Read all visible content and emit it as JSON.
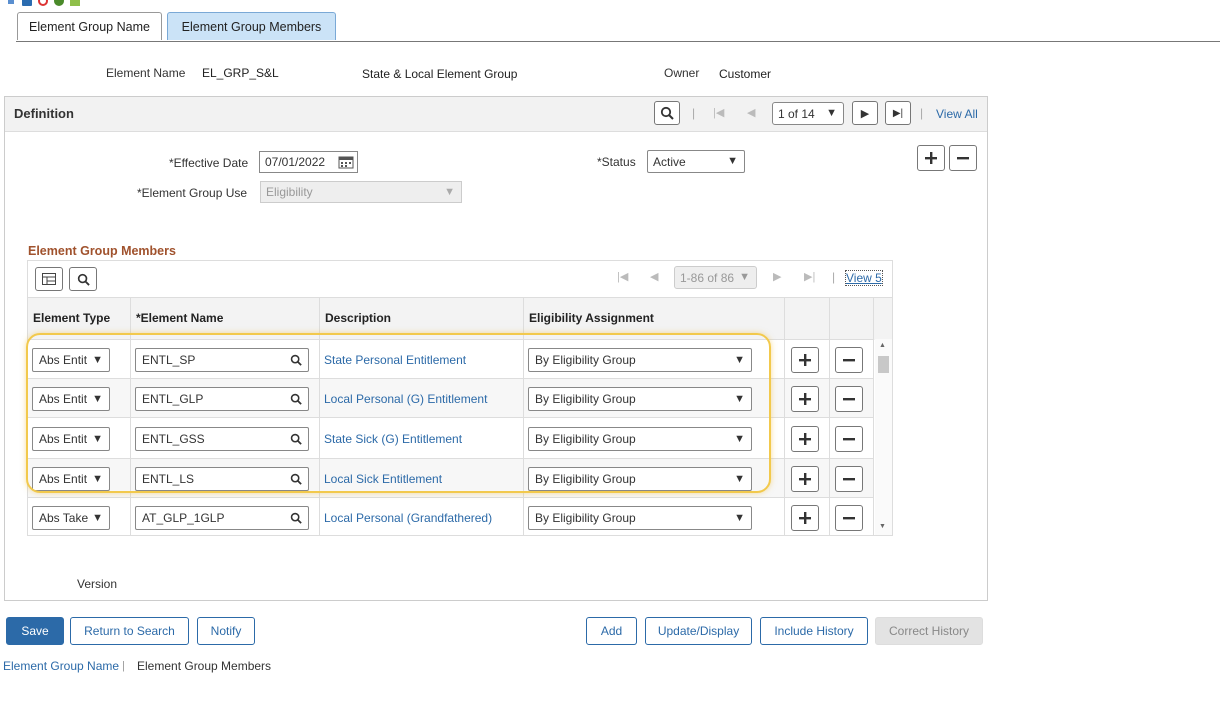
{
  "tabs": [
    {
      "label": "Element Group Name"
    },
    {
      "label": "Element Group Members"
    }
  ],
  "header": {
    "element_name_label": "Element Name",
    "element_name_value": "EL_GRP_S&L",
    "element_desc": "State & Local Element Group",
    "owner_label": "Owner",
    "owner_value": "Customer"
  },
  "definition": {
    "title": "Definition",
    "pager_text": "1 of 14",
    "view_all": "View All",
    "effective_date_label": "*Effective Date",
    "effective_date_value": "07/01/2022",
    "status_label": "*Status",
    "status_value": "Active",
    "group_use_label": "*Element Group Use",
    "group_use_value": "Eligibility"
  },
  "members": {
    "title": "Element Group Members",
    "pager_text": "1-86 of 86",
    "view_link": "View 5",
    "columns": [
      "Element Type",
      "*Element Name",
      "Description",
      "Eligibility Assignment"
    ],
    "rows": [
      {
        "type": "Abs Entit",
        "name": "ENTL_SP",
        "desc": "State Personal Entitlement",
        "assignment": "By Eligibility Group"
      },
      {
        "type": "Abs Entit",
        "name": "ENTL_GLP",
        "desc": "Local Personal (G) Entitlement",
        "assignment": "By Eligibility Group"
      },
      {
        "type": "Abs Entit",
        "name": "ENTL_GSS",
        "desc": "State Sick (G) Entitlement",
        "assignment": "By Eligibility Group"
      },
      {
        "type": "Abs Entit",
        "name": "ENTL_LS",
        "desc": "Local Sick Entitlement",
        "assignment": "By Eligibility Group"
      },
      {
        "type": "Abs Take",
        "name": "AT_GLP_1GLP",
        "desc": "Local Personal (Grandfathered)",
        "assignment": "By Eligibility Group"
      }
    ]
  },
  "version_label": "Version",
  "buttons": {
    "save": "Save",
    "return": "Return to Search",
    "notify": "Notify",
    "add": "Add",
    "update": "Update/Display",
    "include_history": "Include History",
    "correct_history": "Correct History"
  },
  "footer": {
    "link1": "Element Group Name",
    "sep": "|",
    "current": "Element Group Members"
  },
  "colors": {
    "accent": "#2c6aa8",
    "section_title": "#a0522d",
    "highlight": "#f2c94c"
  }
}
